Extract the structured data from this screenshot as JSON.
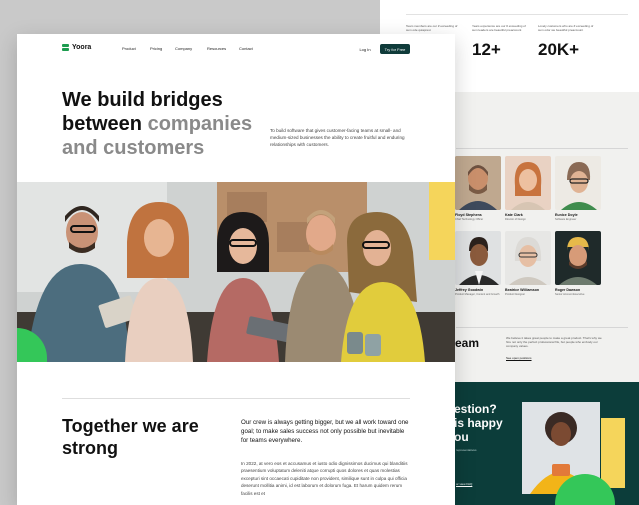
{
  "back_page": {
    "stats": [
      {
        "caption": "Team members are our # exceeding of sum ode quiaprest",
        "value": ""
      },
      {
        "caption": "Years experience are our # exceeding of sum leaders are beautiful preaccount",
        "value": "12+"
      },
      {
        "caption": "Lovely customers who are # exceeding of sum odor we beautiful preaccount",
        "value": "20K+"
      }
    ],
    "team_title": "eam",
    "members": [
      {
        "name": "Floyd Stephens",
        "role": "Chief Technology Officer"
      },
      {
        "name": "Kate Clark",
        "role": "Director of Design"
      },
      {
        "name": "Eunice Doyle",
        "role": "Software Engineer"
      },
      {
        "name": "Jeffrey Goodwin",
        "role": "Product Manager, Content and Growth"
      },
      {
        "name": "Beatrice Williamson",
        "role": "Product Designer"
      },
      {
        "name": "Roger Dawson",
        "role": "Senior Account Executive"
      }
    ],
    "team_title_2": "eam",
    "team_note": "We believe it takes great people to make a great product. That's why we hire not only the perfect professional fits, but people who embody our company values.",
    "team_link": "See open positions",
    "cta_question_lines": [
      "estion?",
      "is happy",
      "ou"
    ],
    "cta_small": "representatives",
    "cta_link": "or view FAQ"
  },
  "nav": {
    "brand": "Yoora",
    "items": [
      "Product",
      "Pricing",
      "Company",
      "Resources",
      "Contact"
    ],
    "login": "Log In",
    "try": "Try for Free"
  },
  "hero": {
    "title_line1": "We build bridges",
    "title_line2_dark": "between ",
    "title_line2_grey": "companies",
    "title_line3": "and customers",
    "paragraph": "To build software that gives customer-facing teams at small- and medium-sized businesses the ability to create fruitful and enduring relationships with customers."
  },
  "strong": {
    "title": "Together we are strong",
    "lead": "Our crew is always getting bigger, but we all work toward one goal; to make sales success not only possible but inevitable for teams everywhere.",
    "body": "In 2022, at vero eos et accusamus et iusto odio dignissimos ducimus qui blanditiis praesentium voluptatum deleniti atque corrupti quos dolores et quas molestias excepturi sint occaecati cupiditate non provident, similique sunt in culpa qui officia deserunt mollitia animi, id est laborum et dolorum fuga. Et harum quidem rerum facilis est et"
  },
  "colors": {
    "brand_dark": "#0f3b3a",
    "brand_green": "#34c759",
    "accent_yellow": "#f5d55b"
  }
}
